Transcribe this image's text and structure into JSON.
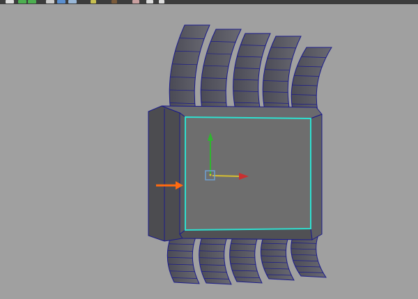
{
  "toolbar": {
    "icons": [
      "render-icon",
      "viewport-icon",
      "layout-icon",
      "sphere-icon",
      "camera-icon",
      "light-icon",
      "texture-icon",
      "grid-icon",
      "snap-icon"
    ]
  },
  "viewport": {
    "background": "#a0a0a0",
    "wire_color": "#1a1a8c",
    "selection_color": "#2ee0d0"
  },
  "manipulator": {
    "y_axis_color": "#2fb52f",
    "x_axis_color": "#c83030",
    "pivot_color": "#6fa0d0"
  },
  "annotation": {
    "arrow_color": "#ff6a10"
  }
}
